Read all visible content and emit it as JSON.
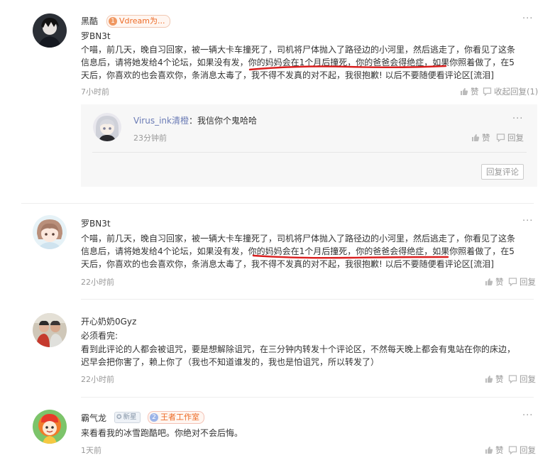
{
  "comments": [
    {
      "user": "黑酷",
      "badge": {
        "level": "1",
        "text": "Vdream为..."
      },
      "lines": [
        "罗BN3t",
        "个喵，前几天，晚自习回家，被一辆大卡车撞死了，司机将尸体抛入了路径边的小河里，然后逃走了，你看见了这条",
        "信息后，请将她发给4个论坛，如果没有发，你的妈妈会在1个月后撞死，你的爸爸会得绝症，如果你照着做了，在5",
        "天后，你喜欢的也会喜欢你，条消息太毒了，我不得不发真的对不起，我很抱歉! 以后不要随便看评论区[流泪]"
      ],
      "time": "7小时前",
      "like_label": "赞",
      "collapse_label": "收起回复",
      "reply_count": "(1)",
      "reply": {
        "user": "Virus_ink清橙",
        "separator": "：",
        "text": "我信你个鬼哈哈",
        "time": "23分钟前",
        "like_label": "赞",
        "reply_label": "回复"
      },
      "reply_button": "回复评论"
    },
    {
      "user": "罗BN3t",
      "lines": [
        "个喵，前几天，晚自习回家，被一辆大卡车撞死了，司机将尸体抛入了路径边的小河里，然后逃走了，你看见了这条",
        "信息后，请将她发给4个论坛，如果没有发，你的妈妈会在1个月后撞死，你的爸爸会得绝症，如果你照着做了，在5",
        "天后，你喜欢的也会喜欢你，条消息太毒了，我不得不发真的对不起，我很抱歉! 以后不要随便看评论区[流泪]"
      ],
      "time": "22小时前",
      "like_label": "赞",
      "reply_label": "回复"
    },
    {
      "user": "开心奶奶0Gyz",
      "lines": [
        "必须看完:",
        "看到此评论的人都会被诅咒，要是想解除诅咒，在三分钟内转发十个评论区，不然每天晚上都会有鬼站在你的床边，",
        "迟早会把你害了，赖上你了（我也不知道谁发的，我也是怕诅咒，所以转发了）"
      ],
      "time": "22小时前",
      "like_label": "赞",
      "reply_label": "回复"
    },
    {
      "user": "霸气龙",
      "level_badge": "新星",
      "badge": {
        "level": "2",
        "text": "王者工作室"
      },
      "lines": [
        "来看看我的冰雪跑酷吧。你绝对不会后悔。"
      ],
      "time": "1天前",
      "like_label": "赞",
      "reply_label": "回复"
    }
  ],
  "icons": {
    "more": "more-dots-icon",
    "like": "thumb-up-icon",
    "reply": "speech-bubble-icon"
  },
  "colors": {
    "accent_link": "#6a7bb5",
    "muted": "#999999",
    "annotation_red": "#d91f1f",
    "badge_orange": "#ed6b27"
  }
}
